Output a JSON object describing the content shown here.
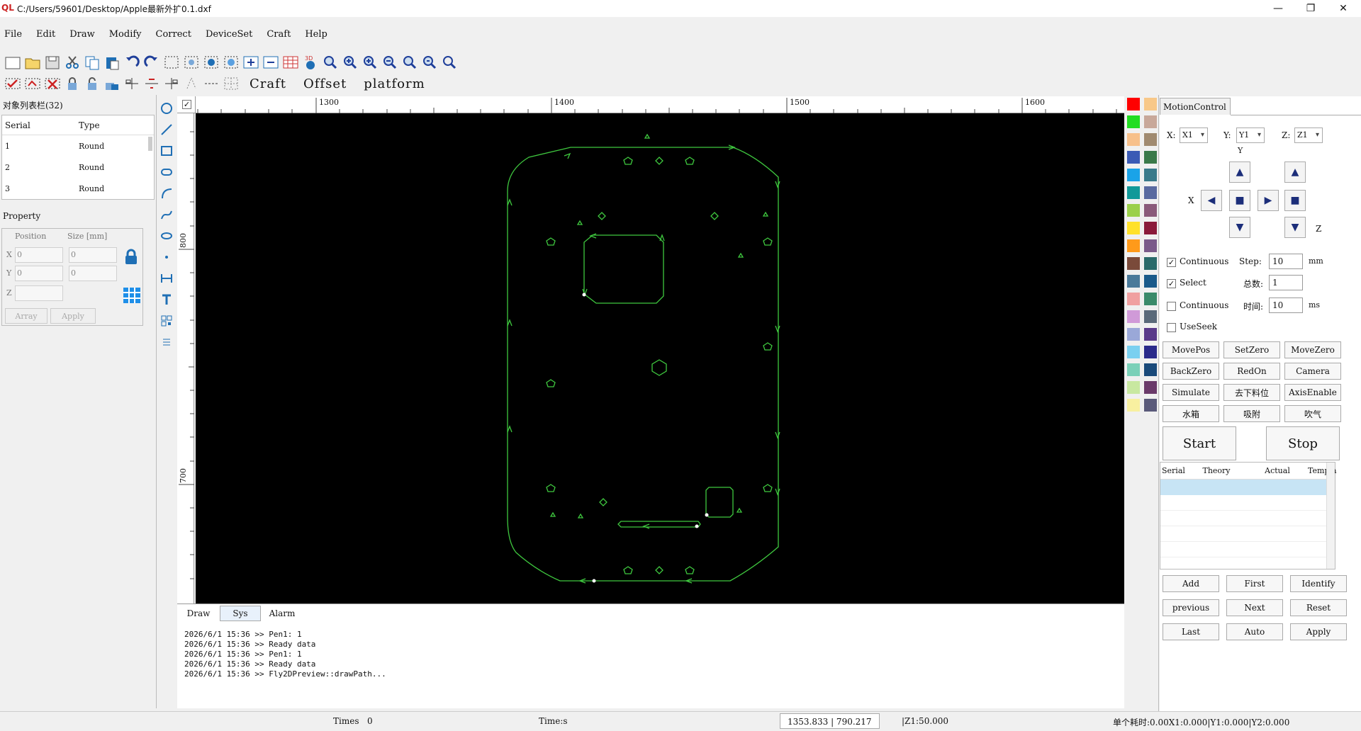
{
  "window": {
    "title": "C:/Users/59601/Desktop/Apple最新外扩0.1.dxf",
    "logo": "QL",
    "minimize": "—",
    "maximize": "❐",
    "close": "✕"
  },
  "menu": [
    "File",
    "Edit",
    "Draw",
    "Modify",
    "Correct",
    "DeviceSet",
    "Craft",
    "Help"
  ],
  "toolbar": {
    "craft_label": "Craft",
    "offset_label": "Offset",
    "platform_label": "platform"
  },
  "object_list": {
    "title": "对象列表栏(32)",
    "headers": [
      "Serial",
      "Type"
    ],
    "rows": [
      {
        "serial": "1",
        "type": "Round"
      },
      {
        "serial": "2",
        "type": "Round"
      },
      {
        "serial": "3",
        "type": "Round"
      }
    ]
  },
  "property": {
    "title": "Property",
    "position_label": "Position",
    "size_label": "Size [mm]",
    "x_label": "X",
    "y_label": "Y",
    "z_label": "Z",
    "x_pos": "0",
    "x_size": "0",
    "y_pos": "0",
    "y_size": "0",
    "array_label": "Array",
    "apply_label": "Apply"
  },
  "ruler": {
    "top_labels": [
      "1300",
      "1400",
      "1500",
      "1600"
    ],
    "left_labels": [
      "800",
      "700"
    ]
  },
  "colors": {
    "path": "#3fc83f",
    "canvas": "#000000",
    "accent": "#1c2e7a",
    "palette_left": [
      "#ff0000",
      "#22dd22",
      "#f7c08a",
      "#3b5bb5",
      "#1aa3e8",
      "#119999",
      "#9bd04a",
      "#ffe12a",
      "#ff9a1a",
      "#7a4a3a",
      "#4a7a9a",
      "#f0a0a0",
      "#d09ad8",
      "#9aa8d8",
      "#7ad0f0",
      "#7ad0b8",
      "#c8e8a0",
      "#f8f0a0"
    ],
    "palette_right": [
      "#f8c888",
      "#c8a89a",
      "#a08a70",
      "#3a7a4a",
      "#3a7a8a",
      "#5a6aa0",
      "#8a5a7a",
      "#8a1a3a",
      "#7a5a8a",
      "#2a6a6a",
      "#1a5a8a",
      "#3a8a6a",
      "#5a6a7a",
      "#5a3a8a",
      "#2a2a8a",
      "#1a4a7a",
      "#6a3a6a",
      "#5a5a7a"
    ]
  },
  "log": {
    "tabs": [
      "Draw",
      "Sys",
      "Alarm"
    ],
    "lines": [
      "2026/6/1 15:36 >> Pen1: 1",
      "2026/6/1 15:36 >> Ready data",
      "2026/6/1 15:36 >> Pen1: 1",
      "2026/6/1 15:36 >> Ready data",
      "2026/6/1 15:36 >> Fly2DPreview::drawPath..."
    ]
  },
  "status": {
    "times_label": "Times",
    "times_value": "0",
    "time_label": "Time:s",
    "coords": "1353.833 | 790.217",
    "z1": "|Z1:50.000",
    "summary": "单个耗时:0.00X1:0.000|Y1:0.000|Y2:0.000"
  },
  "motion": {
    "tab_label": "MotionControl",
    "x_label": "X:",
    "y_label": "Y:",
    "z_label": "Z:",
    "x_axis": "X1",
    "y_axis": "Y1",
    "z_axis": "Z1",
    "y_axis_caption": "Y",
    "x_axis_caption": "X",
    "z_axis_caption": "Z",
    "continuous_label": "Continuous",
    "continuous_checked": true,
    "step_label": "Step:",
    "step_value": "10",
    "step_unit": "mm",
    "select_label": "Select",
    "select_checked": true,
    "total_label": "总数:",
    "total_value": "1",
    "continuous2_label": "Continuous",
    "continuous2_checked": false,
    "time_label": "时间:",
    "time_value": "10",
    "time_unit": "ms",
    "useseek_label": "UseSeek",
    "useseek_checked": false,
    "buttons": [
      "MovePos",
      "SetZero",
      "MoveZero",
      "BackZero",
      "RedOn",
      "Camera",
      "Simulate",
      "去下料位",
      "AxisEnable",
      "水箱",
      "吸附",
      "吹气"
    ],
    "start_label": "Start",
    "stop_label": "Stop",
    "table_headers": [
      "Serial",
      "Theory",
      "Actual",
      "Templa"
    ],
    "bottom_buttons": [
      "Add",
      "First",
      "Identify",
      "previous",
      "Next",
      "Reset",
      "Last",
      "Auto",
      "Apply"
    ]
  }
}
